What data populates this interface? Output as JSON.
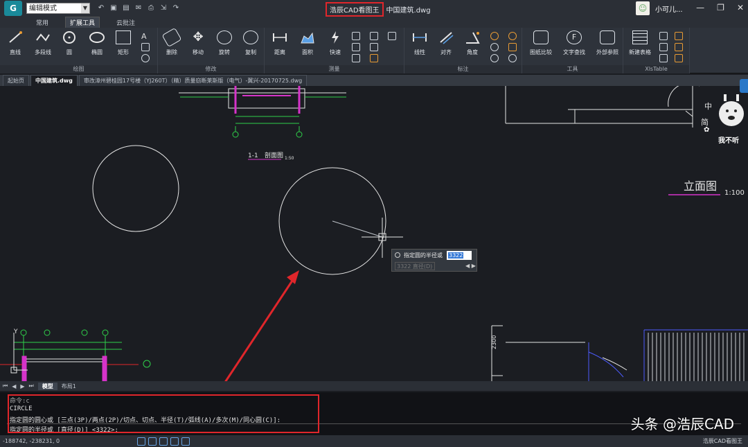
{
  "titlebar": {
    "mode": "编辑模式",
    "app_name": "浩辰CAD看图王",
    "file_name": "中国建筑.dwg",
    "username": "小可儿...",
    "window_controls": [
      "—",
      "❐",
      "✕"
    ]
  },
  "menu": {
    "tabs": [
      "常用",
      "扩展工具",
      "云批注"
    ],
    "active": "扩展工具"
  },
  "ribbon": {
    "groups": [
      {
        "label": "绘图",
        "tools": [
          "直线",
          "多段线",
          "圆",
          "椭圆",
          "矩形"
        ]
      },
      {
        "label": "修改",
        "tools": [
          "删除",
          "移动",
          "旋转",
          "复制"
        ]
      },
      {
        "label": "测量",
        "tools": [
          "距离",
          "面积",
          "快速"
        ]
      },
      {
        "label": "标注",
        "tools": [
          "线性",
          "对齐",
          "角度"
        ]
      },
      {
        "label": "工具",
        "tools": [
          "图纸比较",
          "文字查找",
          "外部参照"
        ]
      },
      {
        "label": "XlsTable",
        "tools": [
          "新建表格"
        ]
      }
    ]
  },
  "doc_tabs": [
    {
      "label": "起始页",
      "active": false
    },
    {
      "label": "中国建筑.dwg",
      "active": true
    },
    {
      "label": "审改漳州碧桂园17号楼（YJ260T）（精）质量窃断莱斯版（电气）-翼兴-20170725.dwg",
      "active": false
    }
  ],
  "drawing": {
    "section_label": "1-1",
    "section_title": "剖面图",
    "section_scale": "1:50",
    "elevation_title": "立面图",
    "elevation_scale": "1:100",
    "dim_text": "2300",
    "side_text": [
      "中",
      "简"
    ],
    "sticker_text": "我不听",
    "axis_y": "Y"
  },
  "radius_prompt": {
    "label": "指定圆的半径或",
    "value": "3322",
    "alt_value": "3322",
    "alt_label": "直径(D)"
  },
  "layout_tabs": {
    "tabs": [
      "模型",
      "布局1"
    ],
    "active": "模型"
  },
  "command": {
    "lines": [
      "命令:c",
      "CIRCLE",
      "指定圆的圆心或 [三点(3P)/两点(2P)/切点、切点、半径(T)/弧线(A)/多次(M)/同心圆(C)]:",
      "指定圆的半径或 [直径(D)] <3322>:"
    ]
  },
  "watermark": "头条 @浩辰CAD",
  "status": {
    "coords": "-188742, -238231, 0",
    "right_text": "浩辰CAD看图王"
  },
  "colors": {
    "highlight_red": "#e0262b",
    "canvas_bg": "#1b1d22",
    "drawing_white": "#e6e6e6",
    "drawing_magenta": "#d633c9",
    "drawing_green": "#2fd14a",
    "drawing_blue": "#4d5cff"
  }
}
